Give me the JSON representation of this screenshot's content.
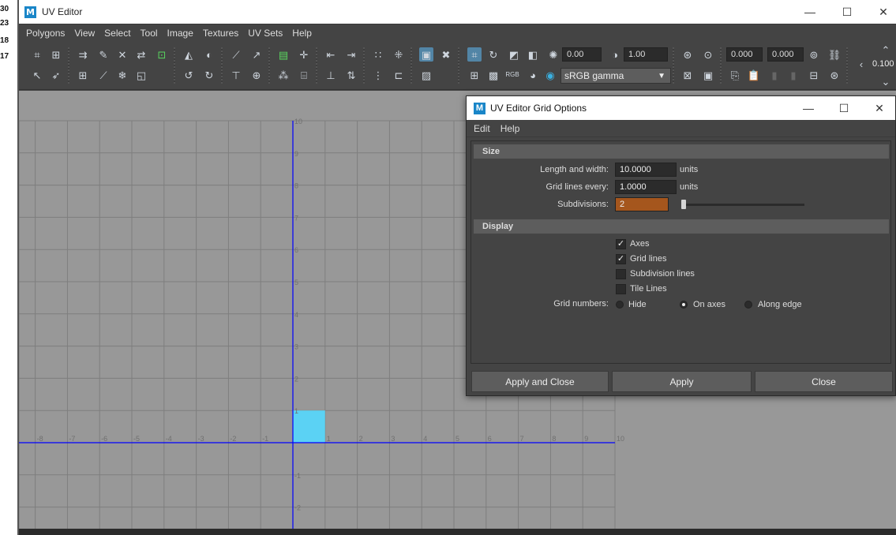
{
  "edge_numbers": [
    "30",
    "23",
    "18",
    "17"
  ],
  "window": {
    "title": "UV Editor",
    "minimize": "—",
    "maximize": "☐",
    "close": "✕"
  },
  "menu": [
    "Polygons",
    "View",
    "Select",
    "Tool",
    "Image",
    "Textures",
    "UV Sets",
    "Help"
  ],
  "toolbar": {
    "exposure": "0.00",
    "gamma": "1.00",
    "colorspace": "sRGB gamma",
    "u_value": "0.000",
    "v_value": "0.000",
    "step": "0.100",
    "rgb_label": "RGB"
  },
  "viewport": {
    "x_axis_labels": [
      "-8",
      "-7",
      "-6",
      "-5",
      "-4",
      "-3",
      "-2",
      "-1",
      "1",
      "2",
      "3",
      "4",
      "5",
      "6",
      "7",
      "8",
      "9",
      "10"
    ],
    "y_axis_labels": [
      "10",
      "9",
      "8",
      "7",
      "6",
      "5",
      "4",
      "3",
      "2",
      "1",
      "-1",
      "-2"
    ],
    "uv_tile_color": "#5bd2f4",
    "axis_color": "#0000ff"
  },
  "dialog": {
    "title": "UV Editor Grid Options",
    "menu": [
      "Edit",
      "Help"
    ],
    "size_header": "Size",
    "length_label": "Length and width:",
    "length_value": "10.0000",
    "grid_every_label": "Grid lines every:",
    "grid_every_value": "1.0000",
    "units": "units",
    "subdivisions_label": "Subdivisions:",
    "subdivisions_value": "2",
    "display_header": "Display",
    "checkboxes": [
      {
        "label": "Axes",
        "checked": true
      },
      {
        "label": "Grid lines",
        "checked": true
      },
      {
        "label": "Subdivision lines",
        "checked": false
      },
      {
        "label": "Tile Lines",
        "checked": false
      }
    ],
    "grid_numbers_label": "Grid numbers:",
    "grid_numbers_options": [
      "Hide",
      "On axes",
      "Along edge"
    ],
    "grid_numbers_selected": "On axes",
    "buttons": {
      "apply_close": "Apply and Close",
      "apply": "Apply",
      "close": "Close"
    }
  }
}
